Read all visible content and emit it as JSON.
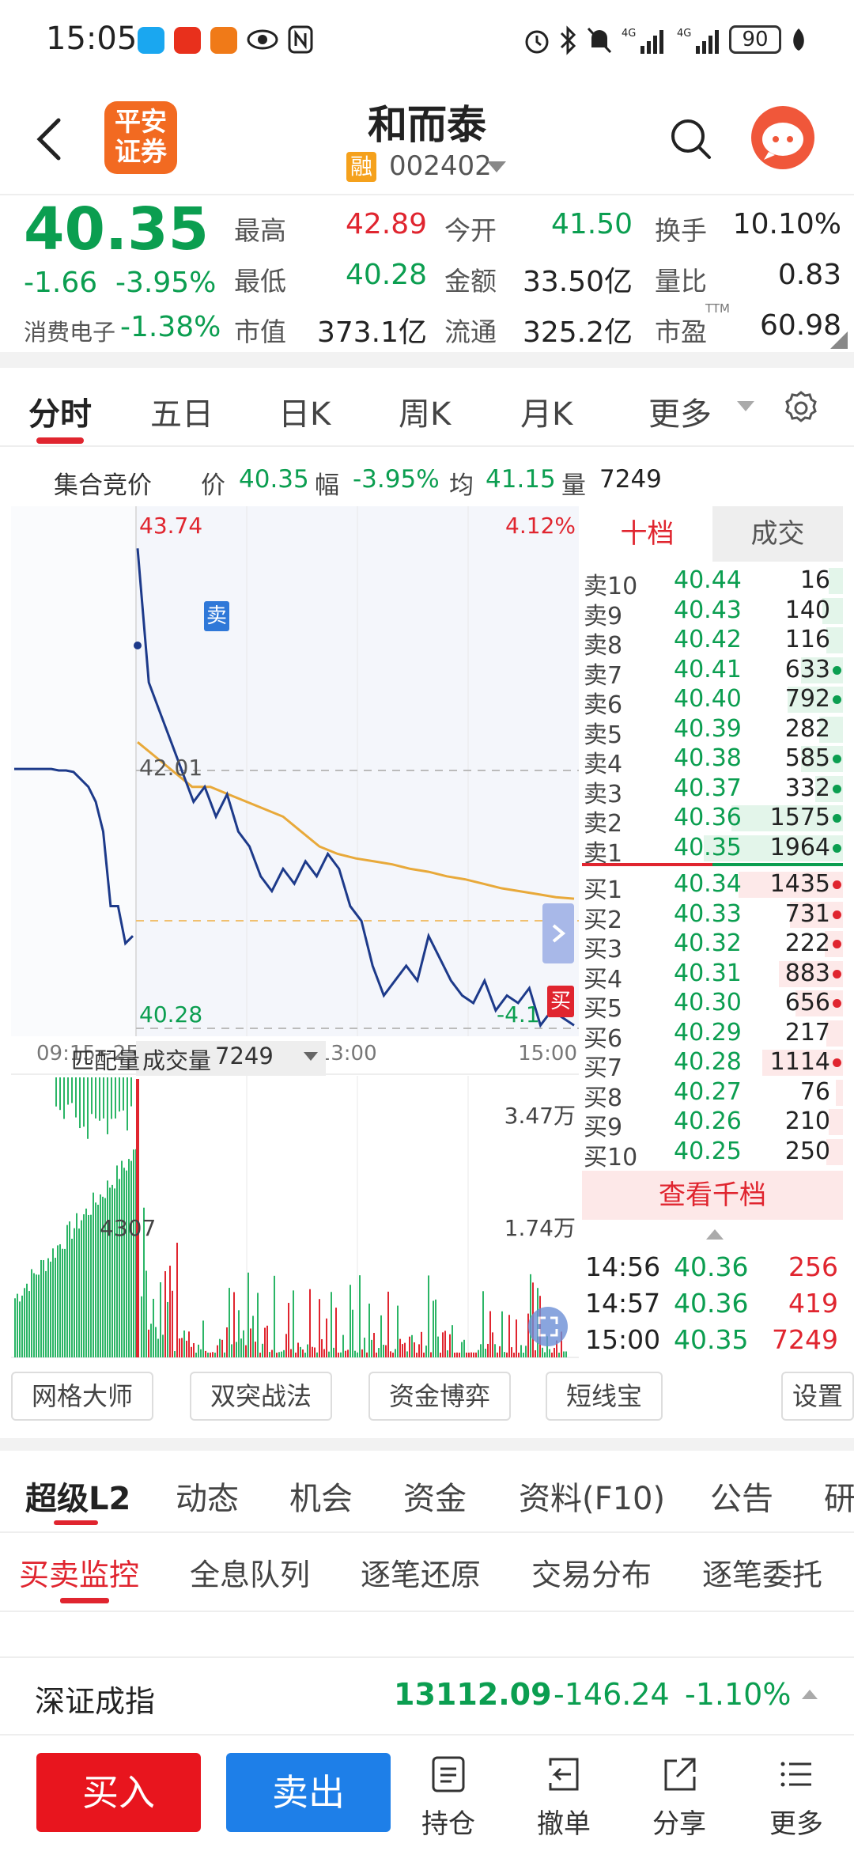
{
  "status_bar": {
    "time": "15:05",
    "battery": "90"
  },
  "header": {
    "stock_name": "和而泰",
    "logo_text_1": "平安",
    "logo_text_2": "证券",
    "margin_badge": "融",
    "stock_code": "002402"
  },
  "quote": {
    "price": "40.35",
    "change": "-1.66",
    "change_pct": "-3.95%",
    "sector_name": "消费电子",
    "sector_change": "-1.38%",
    "high_label": "最高",
    "high": "42.89",
    "open_label": "今开",
    "open": "41.50",
    "turnover_label": "换手",
    "turnover": "10.10%",
    "low_label": "最低",
    "low": "40.28",
    "amount_label": "金额",
    "amount": "33.50亿",
    "vol_ratio_label": "量比",
    "vol_ratio": "0.83",
    "mktcap_label": "市值",
    "mktcap": "373.1亿",
    "float_label": "流通",
    "float_cap": "325.2亿",
    "pe_label": "市盈",
    "pe_sup": "TTM",
    "pe": "60.98"
  },
  "chart_tabs": [
    "分时",
    "五日",
    "日K",
    "周K",
    "月K",
    "更多"
  ],
  "auction": {
    "title": "集合竞价",
    "price_label": "价",
    "price": "40.35",
    "range_label": "幅",
    "range": "-3.95%",
    "avg_label": "均",
    "avg": "41.15",
    "vol_label": "量",
    "vol": "7249"
  },
  "chart_data": {
    "type": "line",
    "y_top_label": "43.74",
    "y_bottom_label": "40.28",
    "mid_label": "42.01",
    "pct_top_label": "4.12%",
    "pct_bottom_label": "-4.1",
    "x_labels": [
      "09:15~25",
      "09:30",
      "11:30/13:00",
      "15:00"
    ],
    "sell_marker": "卖",
    "buy_marker": "买",
    "prev_close": 42.01,
    "ylim": [
      40.28,
      43.74
    ],
    "auction_series": [
      42.02,
      42.02,
      42.02,
      42.02,
      42.02,
      42.02,
      42.01,
      42.01,
      42.0,
      41.95,
      41.9,
      41.8,
      41.6,
      41.1,
      41.1,
      40.85,
      40.9
    ],
    "price_series": [
      43.5,
      42.6,
      42.4,
      42.2,
      42.0,
      41.8,
      41.9,
      41.7,
      41.85,
      41.6,
      41.5,
      41.3,
      41.2,
      41.35,
      41.25,
      41.4,
      41.3,
      41.45,
      41.35,
      41.1,
      41.0,
      40.7,
      40.5,
      40.6,
      40.7,
      40.6,
      40.9,
      40.75,
      40.6,
      40.5,
      40.45,
      40.6,
      40.4,
      40.5,
      40.45,
      40.55,
      40.3,
      40.4,
      40.35,
      40.3
    ],
    "avg_series": [
      42.2,
      42.1,
      42.0,
      41.9,
      41.9,
      41.85,
      41.8,
      41.75,
      41.7,
      41.6,
      41.5,
      41.45,
      41.42,
      41.4,
      41.38,
      41.35,
      41.33,
      41.3,
      41.28,
      41.25,
      41.22,
      41.2,
      41.18,
      41.16,
      41.15
    ],
    "volume_labels": {
      "match_label": "匹配量",
      "vol_label": "成交量",
      "vol_value": "7249",
      "top": "3.47万",
      "mid": "1.74万",
      "auction_match": "4307"
    }
  },
  "orderbook": {
    "tab_levels": "十档",
    "tab_trades": "成交",
    "asks": [
      {
        "label": "卖10",
        "price": "40.44",
        "vol": "16",
        "bar": 0.1,
        "dot": false
      },
      {
        "label": "卖9",
        "price": "40.43",
        "vol": "140",
        "bar": 0.15,
        "dot": false
      },
      {
        "label": "卖8",
        "price": "40.42",
        "vol": "116",
        "bar": 0.12,
        "dot": false
      },
      {
        "label": "卖7",
        "price": "40.41",
        "vol": "633",
        "bar": 0.3,
        "dot": true
      },
      {
        "label": "卖6",
        "price": "40.40",
        "vol": "792",
        "bar": 0.4,
        "dot": true
      },
      {
        "label": "卖5",
        "price": "40.39",
        "vol": "282",
        "bar": 0.17,
        "dot": false
      },
      {
        "label": "卖4",
        "price": "40.38",
        "vol": "585",
        "bar": 0.3,
        "dot": true
      },
      {
        "label": "卖3",
        "price": "40.37",
        "vol": "332",
        "bar": 0.2,
        "dot": true
      },
      {
        "label": "卖2",
        "price": "40.36",
        "vol": "1575",
        "bar": 0.8,
        "dot": true
      },
      {
        "label": "卖1",
        "price": "40.35",
        "vol": "1964",
        "bar": 1.0,
        "dot": true
      }
    ],
    "bids": [
      {
        "label": "买1",
        "price": "40.34",
        "vol": "1435",
        "bar": 0.75,
        "dot": true
      },
      {
        "label": "买2",
        "price": "40.33",
        "vol": "731",
        "bar": 0.38,
        "dot": true
      },
      {
        "label": "买3",
        "price": "40.32",
        "vol": "222",
        "bar": 0.13,
        "dot": true
      },
      {
        "label": "买4",
        "price": "40.31",
        "vol": "883",
        "bar": 0.46,
        "dot": true
      },
      {
        "label": "买5",
        "price": "40.30",
        "vol": "656",
        "bar": 0.34,
        "dot": true
      },
      {
        "label": "买6",
        "price": "40.29",
        "vol": "217",
        "bar": 0.12,
        "dot": false
      },
      {
        "label": "买7",
        "price": "40.28",
        "vol": "1114",
        "bar": 0.58,
        "dot": true
      },
      {
        "label": "买8",
        "price": "40.27",
        "vol": "76",
        "bar": 0.05,
        "dot": false
      },
      {
        "label": "买9",
        "price": "40.26",
        "vol": "210",
        "bar": 0.1,
        "dot": false
      },
      {
        "label": "买10",
        "price": "40.25",
        "vol": "250",
        "bar": 0.12,
        "dot": false
      }
    ],
    "view_thousand": "查看千档",
    "ticks": [
      {
        "time": "14:56",
        "price": "40.36",
        "vol": "256"
      },
      {
        "time": "14:57",
        "price": "40.36",
        "vol": "419"
      },
      {
        "time": "15:00",
        "price": "40.35",
        "vol": "7249"
      }
    ]
  },
  "tools": [
    "网格大师",
    "双突战法",
    "资金博弈",
    "短线宝",
    "设置"
  ],
  "l2_tabs": [
    "超级L2",
    "动态",
    "机会",
    "资金",
    "资料(F10)",
    "公告",
    "研"
  ],
  "sub_tabs": [
    "买卖监控",
    "全息队列",
    "逐笔还原",
    "交易分布",
    "逐笔委托"
  ],
  "index_bar": {
    "name": "深证成指",
    "value": "13112.09",
    "change": "-146.24",
    "change_pct": "-1.10%"
  },
  "bottom_bar": {
    "buy": "买入",
    "sell": "卖出",
    "position": "持仓",
    "cancel": "撤单",
    "share": "分享",
    "more": "更多"
  },
  "colors": {
    "up": "#e0252f",
    "down": "#0b9e50",
    "price_line": "#1d3a8a",
    "avg_line": "#e8a93a",
    "accent": "#f26a21"
  }
}
